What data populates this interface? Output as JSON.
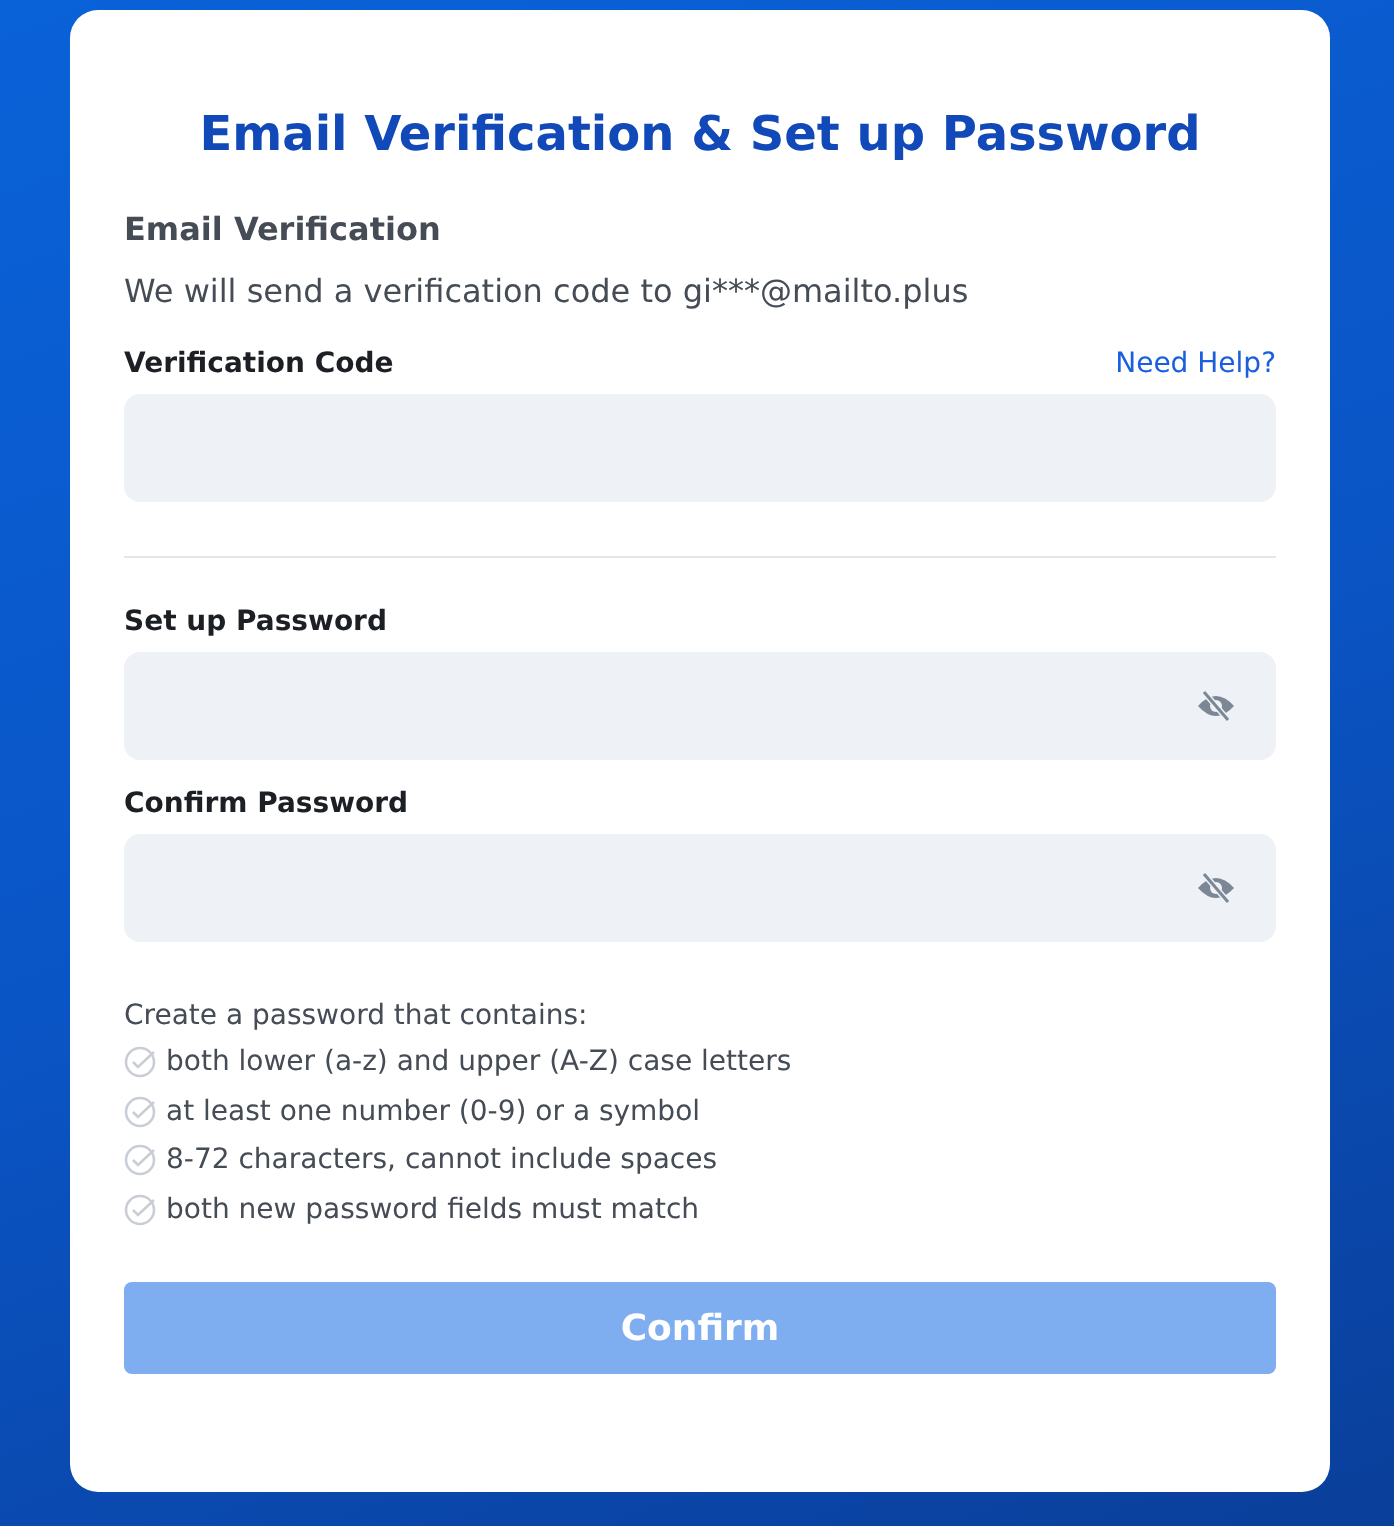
{
  "title": "Email Verification & Set up Password",
  "email_section": {
    "heading": "Email Verification",
    "message": "We will send a verification code to gi***@mailto.plus"
  },
  "code_field": {
    "label": "Verification Code",
    "help_link": "Need Help?"
  },
  "password_fields": [
    {
      "label": "Set up Password",
      "masked": true
    },
    {
      "label": "Confirm Password",
      "masked": true
    }
  ],
  "requirements": {
    "intro": "Create a password that contains:",
    "items": [
      {
        "text": "both lower (a-z) and upper (A-Z) case letters",
        "met": false
      },
      {
        "text": "at least one number (0-9) or a symbol",
        "met": false
      },
      {
        "text": "8-72 characters, cannot include spaces",
        "met": false
      },
      {
        "text": "both new password fields must match",
        "met": false
      }
    ]
  },
  "confirm_button": {
    "label": "Confirm",
    "disabled": true
  }
}
